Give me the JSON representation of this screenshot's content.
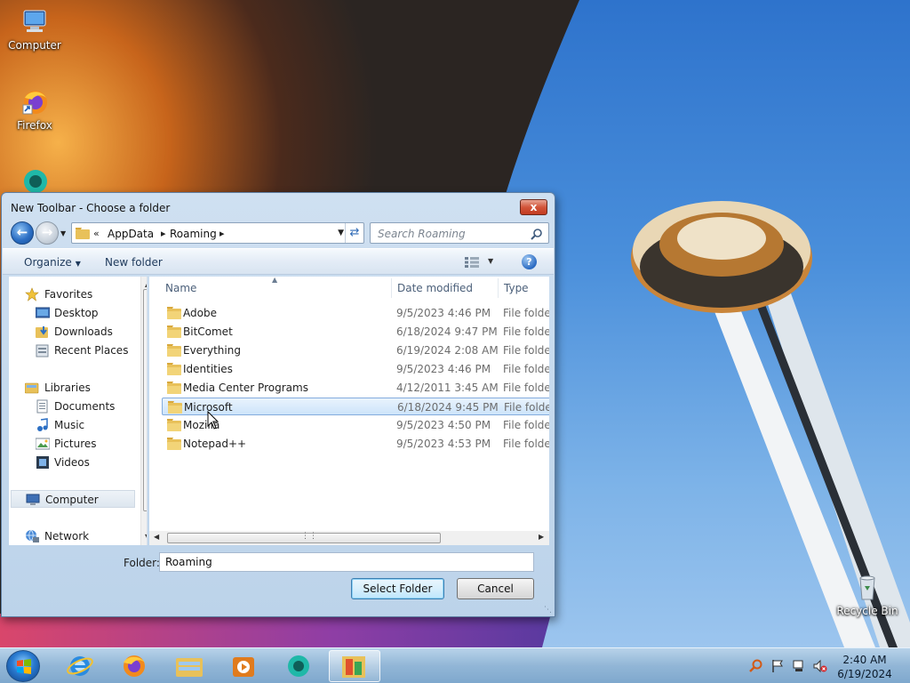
{
  "desktop": {
    "icons": [
      {
        "label": "Computer"
      },
      {
        "label": "Firefox"
      },
      {
        "label": "Recycle Bin"
      }
    ]
  },
  "dialog": {
    "title": "New Toolbar - Choose a folder",
    "close_label": "x",
    "address": {
      "overflow": "«",
      "crumbs": [
        "AppData",
        "Roaming"
      ]
    },
    "search_placeholder": "Search Roaming",
    "commands": {
      "organize": "Organize",
      "new_folder": "New folder"
    },
    "help_label": "?",
    "nav": {
      "favorites": {
        "label": "Favorites",
        "items": [
          "Desktop",
          "Downloads",
          "Recent Places"
        ]
      },
      "libraries": {
        "label": "Libraries",
        "items": [
          "Documents",
          "Music",
          "Pictures",
          "Videos"
        ]
      },
      "computer": "Computer",
      "network": "Network"
    },
    "columns": {
      "name": "Name",
      "date": "Date modified",
      "type": "Type"
    },
    "files": [
      {
        "name": "Adobe",
        "date": "9/5/2023 4:46 PM",
        "type": "File folder"
      },
      {
        "name": "BitComet",
        "date": "6/18/2024 9:47 PM",
        "type": "File folder"
      },
      {
        "name": "Everything",
        "date": "6/19/2024 2:08 AM",
        "type": "File folder"
      },
      {
        "name": "Identities",
        "date": "9/5/2023 4:46 PM",
        "type": "File folder"
      },
      {
        "name": "Media Center Programs",
        "date": "4/12/2011 3:45 AM",
        "type": "File folder"
      },
      {
        "name": "Microsoft",
        "date": "6/18/2024 9:45 PM",
        "type": "File folder"
      },
      {
        "name": "Mozilla",
        "date": "9/5/2023 4:50 PM",
        "type": "File folder"
      },
      {
        "name": "Notepad++",
        "date": "9/5/2023 4:53 PM",
        "type": "File folder"
      }
    ],
    "selected_index": 5,
    "folder_label": "Folder:",
    "folder_value": "Roaming",
    "buttons": {
      "select": "Select Folder",
      "cancel": "Cancel"
    }
  },
  "taskbar": {
    "apps": [
      "internet-explorer",
      "firefox",
      "file-explorer",
      "media-player",
      "chat-app",
      "active-app"
    ],
    "clock": {
      "time": "2:40 AM",
      "date": "6/19/2024"
    }
  },
  "colors": {
    "accent": "#3c7fb1",
    "selection": "#cde4fa",
    "folder": "#e8c15a"
  }
}
